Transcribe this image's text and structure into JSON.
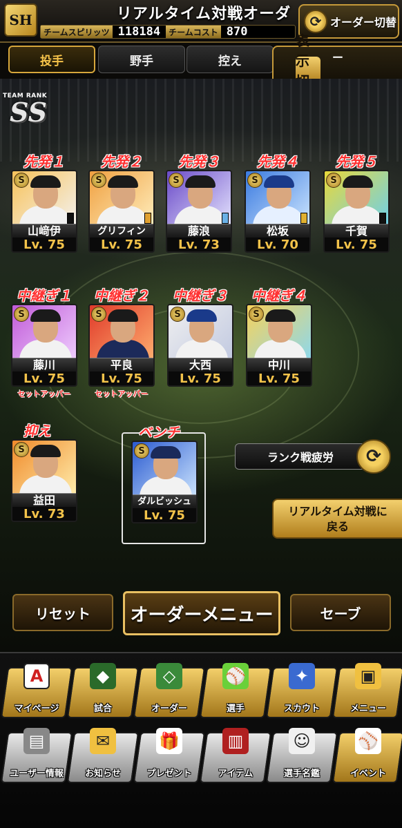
{
  "header": {
    "logo_text": "SH",
    "title": "リアルタイム対戦オーダー",
    "team_spirit_label": "チームスピリッツ",
    "team_spirit_value": "118184",
    "team_cost_label": "チームコスト",
    "team_cost_value": "870",
    "order_switch_label": "オーダー切替"
  },
  "tabs": [
    {
      "label": "投手",
      "active": true
    },
    {
      "label": "野手",
      "active": false
    },
    {
      "label": "控え",
      "active": false
    }
  ],
  "display_toggle": {
    "label": "表示切替",
    "value": "ー"
  },
  "team_rank": {
    "caption": "TEAM RANK",
    "rank": "SS"
  },
  "starters": [
    {
      "slot": "先発１",
      "name": "山﨑伊",
      "level": "Lv. 75",
      "chip": "#111111"
    },
    {
      "slot": "先発２",
      "name": "グリフィン",
      "level": "Lv. 75",
      "chip": "#e0a030"
    },
    {
      "slot": "先発３",
      "name": "藤浪",
      "level": "Lv. 73",
      "chip": "#6ab0e6"
    },
    {
      "slot": "先発４",
      "name": "松坂",
      "level": "Lv. 70",
      "chip": "#e0b030"
    },
    {
      "slot": "先発５",
      "name": "千賀",
      "level": "Lv. 75",
      "chip": "#111111"
    }
  ],
  "relievers": [
    {
      "slot": "中継ぎ１",
      "name": "藤川",
      "level": "Lv. 75",
      "role": "セットアッパー"
    },
    {
      "slot": "中継ぎ２",
      "name": "平良",
      "level": "Lv. 75",
      "role": "セットアッパー"
    },
    {
      "slot": "中継ぎ３",
      "name": "大西",
      "level": "Lv. 75",
      "role": ""
    },
    {
      "slot": "中継ぎ４",
      "name": "中川",
      "level": "Lv. 75",
      "role": ""
    }
  ],
  "closer": {
    "slot": "抑え",
    "name": "益田",
    "level": "Lv. 73"
  },
  "bench": {
    "slot": "ベンチ",
    "name": "ダルビッシュ",
    "level": "Lv. 75"
  },
  "rank_fatigue_label": "ランク戦疲労",
  "back_button": {
    "line1": "リアルタイム対戦に",
    "line2": "戻る"
  },
  "actions": {
    "reset": "リセット",
    "order_menu": "オーダーメニュー",
    "save": "セーブ"
  },
  "nav_row1": [
    {
      "label": "マイページ",
      "icon": "A"
    },
    {
      "label": "試合",
      "icon": "◆"
    },
    {
      "label": "オーダー",
      "icon": "◇"
    },
    {
      "label": "選手",
      "icon": "⚾"
    },
    {
      "label": "スカウト",
      "icon": "✦"
    },
    {
      "label": "メニュー",
      "icon": "▣"
    }
  ],
  "nav_row2": [
    {
      "label": "ユーザー情報",
      "icon": "▤"
    },
    {
      "label": "お知らせ",
      "icon": "✉"
    },
    {
      "label": "プレゼント",
      "icon": "🎁"
    },
    {
      "label": "アイテム",
      "icon": "▥"
    },
    {
      "label": "選手名鑑",
      "icon": "☺"
    },
    {
      "label": "イベント",
      "icon": "⚾"
    }
  ],
  "colors": {
    "accent_gold": "#f3c34a",
    "slot_red": "#ff3030",
    "brand_dark": "#0b0a08"
  }
}
